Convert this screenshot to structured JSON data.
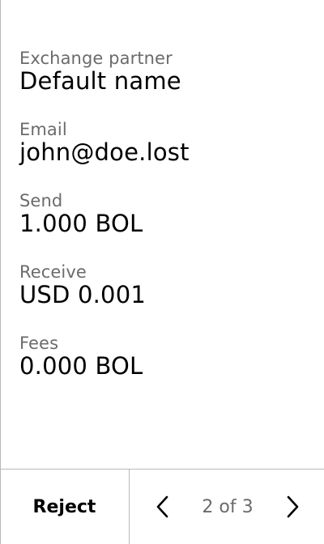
{
  "fields": [
    {
      "label": "Exchange partner",
      "value": "Default name"
    },
    {
      "label": "Email",
      "value": "john@doe.lost"
    },
    {
      "label": "Send",
      "value": "1.000 BOL"
    },
    {
      "label": "Receive",
      "value": "USD 0.001"
    },
    {
      "label": "Fees",
      "value": "0.000 BOL"
    }
  ],
  "footer": {
    "reject_label": "Reject",
    "page_indicator": "2 of 3",
    "prev_icon": "chevron-left-icon",
    "next_icon": "chevron-right-icon"
  },
  "colors": {
    "label": "#6b6b6b",
    "value": "#000000",
    "divider": "#b9b9b9",
    "background": "#ffffff"
  }
}
